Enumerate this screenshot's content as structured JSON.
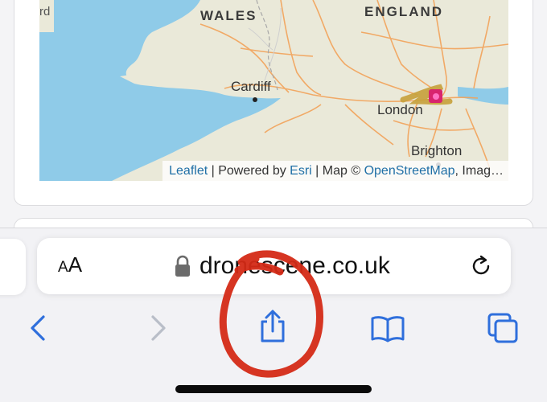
{
  "map": {
    "partial_label": "rd",
    "regions": {
      "wales": "WALES",
      "england": "ENGLAND"
    },
    "cities": {
      "cardiff": "Cardiff",
      "london": "London",
      "brighton": "Brighton"
    },
    "attribution": {
      "leaflet": "Leaflet",
      "sep1": " | Powered by ",
      "esri": "Esri",
      "sep2": " | Map © ",
      "osm": "OpenStreetMap",
      "tail": ", Imag…"
    },
    "colors": {
      "sea": "#8fcbe8",
      "land": "#eae9d9",
      "roads": "#f2a35a",
      "route": "#c7a03a",
      "marker": "#d8246e"
    }
  },
  "browser": {
    "text_size_button": {
      "small": "A",
      "large": "A"
    },
    "url": "dronescene.co.uk",
    "icons": [
      "lock-icon",
      "reload-icon",
      "back-icon",
      "forward-icon",
      "share-icon",
      "bookmarks-icon",
      "tabs-icon"
    ],
    "accent": "#2f6fdc"
  },
  "annotation": {
    "color": "#d42a16",
    "target": "share-button"
  }
}
